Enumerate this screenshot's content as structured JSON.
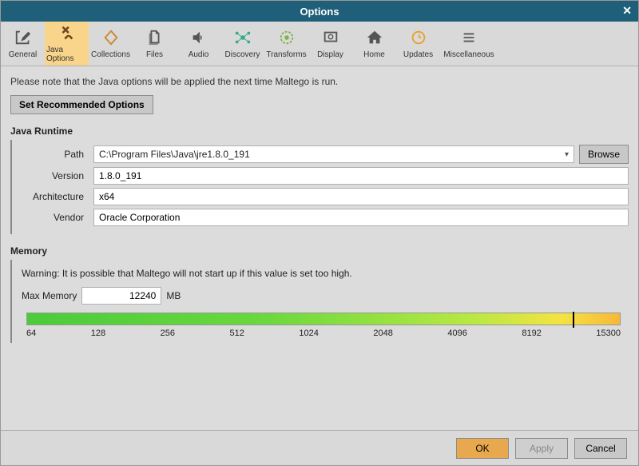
{
  "window": {
    "title": "Options"
  },
  "toolbar": {
    "items": [
      {
        "label": "General"
      },
      {
        "label": "Java Options"
      },
      {
        "label": "Collections"
      },
      {
        "label": "Files"
      },
      {
        "label": "Audio"
      },
      {
        "label": "Discovery"
      },
      {
        "label": "Transforms"
      },
      {
        "label": "Display"
      },
      {
        "label": "Home"
      },
      {
        "label": "Updates"
      },
      {
        "label": "Miscellaneous"
      }
    ],
    "active_index": 1
  },
  "note": "Please note that the Java options will be applied the next time Maltego is run.",
  "set_recommended": "Set Recommended Options",
  "runtime": {
    "title": "Java Runtime",
    "path_label": "Path",
    "path_value": "C:\\Program Files\\Java\\jre1.8.0_191",
    "browse": "Browse",
    "version_label": "Version",
    "version_value": "1.8.0_191",
    "arch_label": "Architecture",
    "arch_value": "x64",
    "vendor_label": "Vendor",
    "vendor_value": "Oracle Corporation"
  },
  "memory": {
    "title": "Memory",
    "warning": "Warning: It is possible that Maltego will not start up if this value is set too high.",
    "max_label": "Max Memory",
    "max_value": "12240",
    "unit": "MB",
    "ticks": [
      "64",
      "128",
      "256",
      "512",
      "1024",
      "2048",
      "4096",
      "8192",
      "15300"
    ],
    "slider_percent": 92
  },
  "footer": {
    "ok": "OK",
    "apply": "Apply",
    "cancel": "Cancel"
  }
}
